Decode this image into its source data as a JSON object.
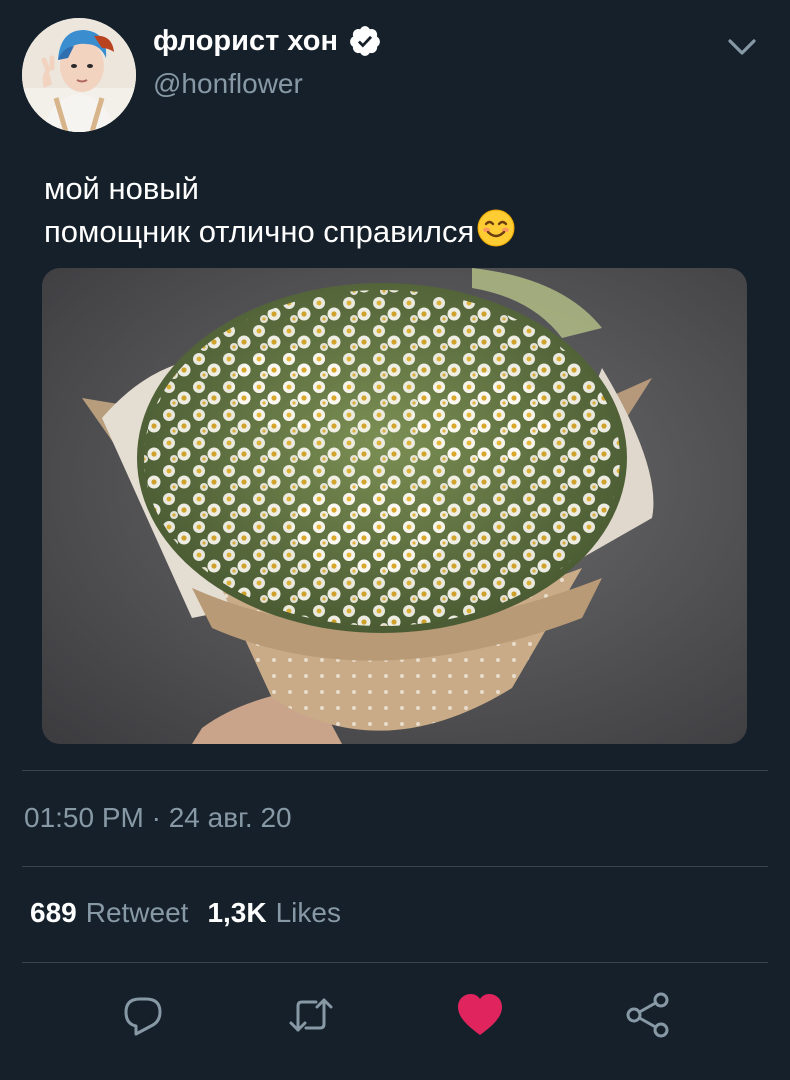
{
  "tweet": {
    "display_name": "флорист хон",
    "handle": "@honflower",
    "text_line1": "мой новый",
    "text_line2": "помощник отлично справился",
    "timestamp": "01:50 PM · 24 авг. 20"
  },
  "stats": {
    "retweets_count": "689",
    "retweets_label": "Retweet",
    "likes_count": "1,3K",
    "likes_label": "Likes"
  },
  "icons": {
    "verified": "verified-badge-icon",
    "menu": "chevron-down-icon",
    "emoji": "smiling-face-emoji",
    "reply": "reply-icon",
    "retweet": "retweet-icon",
    "like": "heart-icon",
    "share": "share-icon"
  },
  "colors": {
    "background": "#15202b",
    "secondary_text": "#8899a6",
    "divider": "#38444d",
    "like_active": "#e0245e"
  }
}
